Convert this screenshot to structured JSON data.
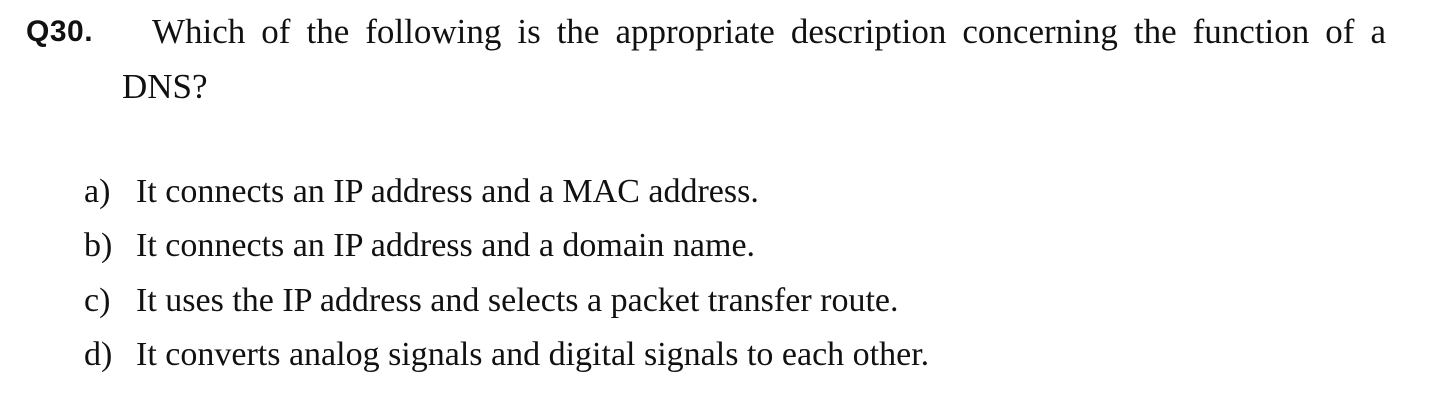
{
  "question": {
    "number": "Q30.",
    "text_line1": "Which of the following is the appropriate description concerning the function of a",
    "text_line2": "DNS?"
  },
  "options": [
    {
      "letter": "a)",
      "text": "It connects an IP address and a MAC address."
    },
    {
      "letter": "b)",
      "text": "It connects an IP address and a domain name."
    },
    {
      "letter": "c)",
      "text": "It uses the IP address and selects a packet transfer route."
    },
    {
      "letter": "d)",
      "text": "It converts analog signals and digital signals to each other."
    }
  ]
}
